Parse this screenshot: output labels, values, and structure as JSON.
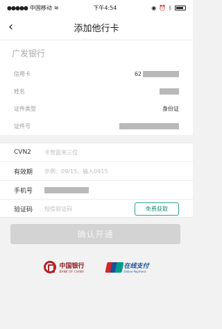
{
  "status_bar": {
    "carrier": "中国移动",
    "time": "下午4:54"
  },
  "nav": {
    "title": "添加他行卡",
    "back_icon": "‹"
  },
  "bank": {
    "name": "广发银行"
  },
  "card_info": {
    "rows": [
      {
        "label": "信用卡",
        "value_prefix": "62"
      },
      {
        "label": "姓名",
        "value_prefix": ""
      },
      {
        "label": "证件类型",
        "value": "身份证"
      },
      {
        "label": "证件号",
        "value_prefix": ""
      }
    ]
  },
  "form": {
    "cvn2": {
      "label": "CVN2",
      "placeholder": "卡背面末三位"
    },
    "expiry": {
      "label": "有效期",
      "placeholder": "示例：09/15，输入0915"
    },
    "phone": {
      "label": "手机号",
      "value": ""
    },
    "sms": {
      "label": "验证码",
      "placeholder": "短信验证码",
      "button": "免费获取"
    }
  },
  "confirm": {
    "label": "确认开通"
  },
  "logos": {
    "boc_cn": "中国银行",
    "boc_en": "BANK OF CHINA",
    "unionpay_brand": "UnionPay 银联",
    "unionpay_cn": "在线支付",
    "unionpay_en": "Online Payment"
  },
  "colors": {
    "accent": "#1a8f77",
    "boc_red": "#b2222a",
    "unionpay_blue": "#1b4f9c"
  }
}
